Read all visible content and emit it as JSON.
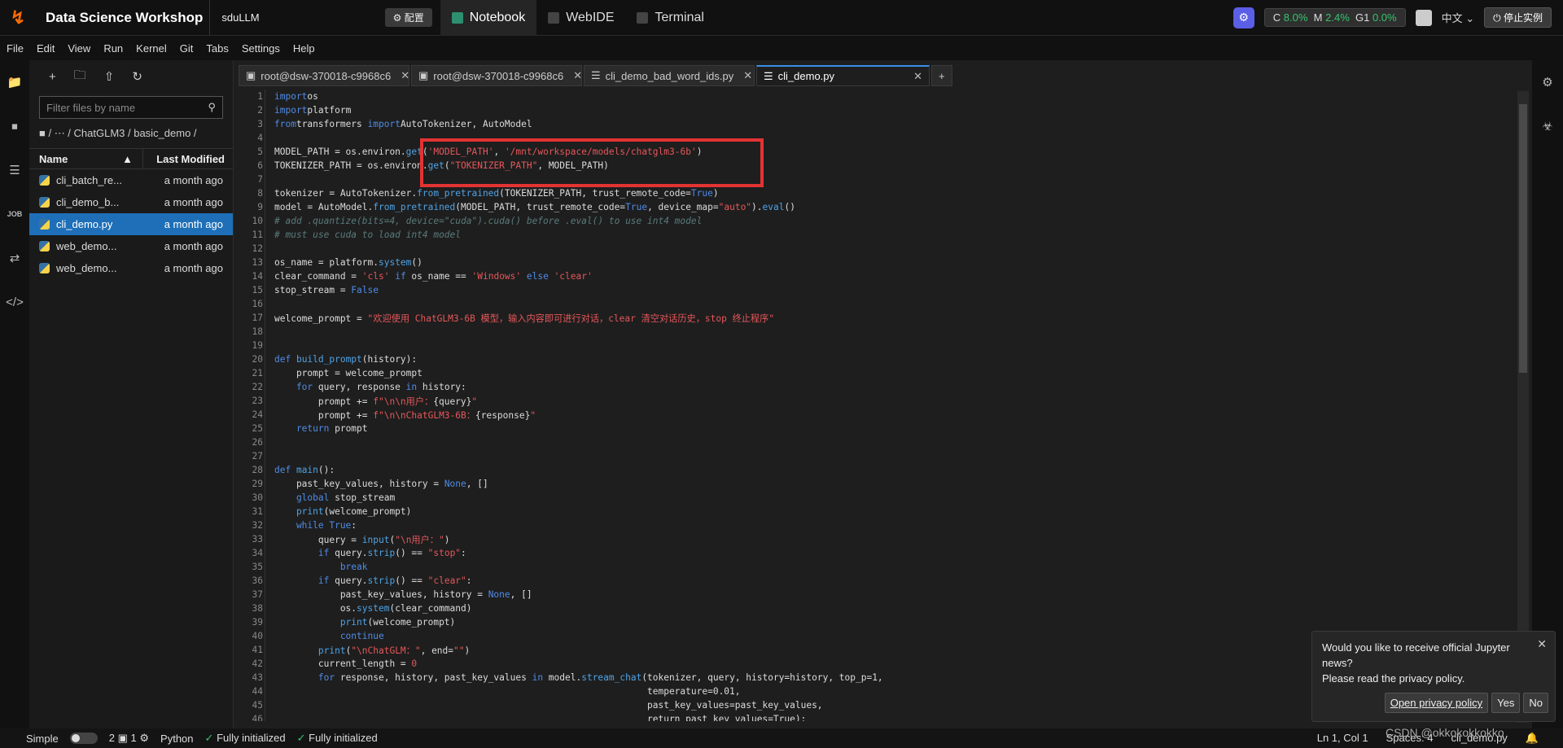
{
  "topbar": {
    "app_title": "Data Science Workshop",
    "project": "sduLLM",
    "config_label": "⚙ 配置",
    "tabs": [
      {
        "label": "Notebook"
      },
      {
        "label": "WebIDE"
      },
      {
        "label": "Terminal"
      }
    ],
    "metrics": {
      "c_label": "C",
      "c_val": "8.0%",
      "m_label": "M",
      "m_val": "2.4%",
      "g_label": "G1",
      "g_val": "0.0%"
    },
    "language": "中文",
    "stop_label": "停止实例"
  },
  "menu": [
    "File",
    "Edit",
    "View",
    "Run",
    "Kernel",
    "Git",
    "Tabs",
    "Settings",
    "Help"
  ],
  "filebrowser": {
    "filter_placeholder": "Filter files by name",
    "breadcrumb": "■ /  ⋯  / ChatGLM3 / basic_demo /",
    "col_name": "Name",
    "col_modified": "Last Modified",
    "rows": [
      {
        "name": "cli_batch_re...",
        "modified": "a month ago"
      },
      {
        "name": "cli_demo_b...",
        "modified": "a month ago"
      },
      {
        "name": "cli_demo.py",
        "modified": "a month ago"
      },
      {
        "name": "web_demo...",
        "modified": "a month ago"
      },
      {
        "name": "web_demo...",
        "modified": "a month ago"
      }
    ]
  },
  "editor_tabs": [
    {
      "label": "root@dsw-370018-c9968c6"
    },
    {
      "label": "root@dsw-370018-c9968c6"
    },
    {
      "label": "cli_demo_bad_word_ids.py"
    },
    {
      "label": "cli_demo.py"
    }
  ],
  "notification": {
    "text1": "Would you like to receive official Jupyter news?",
    "text2": "Please read the privacy policy.",
    "btn_policy": "Open privacy policy",
    "btn_yes": "Yes",
    "btn_no": "No"
  },
  "statusbar": {
    "mode": "Simple",
    "num1": "2",
    "num2": "1",
    "kernel": "Python",
    "init1": "Fully initialized",
    "init2": "Fully initialized",
    "position": "Ln 1, Col 1",
    "spaces": "Spaces: 4",
    "file": "cli_demo.py"
  },
  "watermark": "CSDN @okkokokkokko",
  "colors": {
    "accent": "#1e6fb8",
    "highlight": "#e33333",
    "brand": "#ff6a00"
  }
}
